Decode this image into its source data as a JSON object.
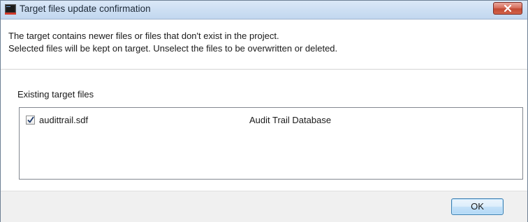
{
  "window": {
    "title": "Target files update confirmation",
    "icon": "app-terminal-icon",
    "close_icon": "close-icon"
  },
  "message": {
    "line1": "The target contains newer files or files that don't exist in the project.",
    "line2": "Selected files will be kept on target. Unselect the files to be overwritten or deleted."
  },
  "existing_files": {
    "label": "Existing target files",
    "items": [
      {
        "name": "audittrail.sdf",
        "description": "Audit Trail Database",
        "checked": true
      }
    ]
  },
  "buttons": {
    "ok_label": "OK"
  },
  "colors": {
    "titlebar": "#c9dcf2",
    "close_button": "#c94a33",
    "ok_border": "#3c7fb1",
    "background": "#f0f0f0"
  }
}
